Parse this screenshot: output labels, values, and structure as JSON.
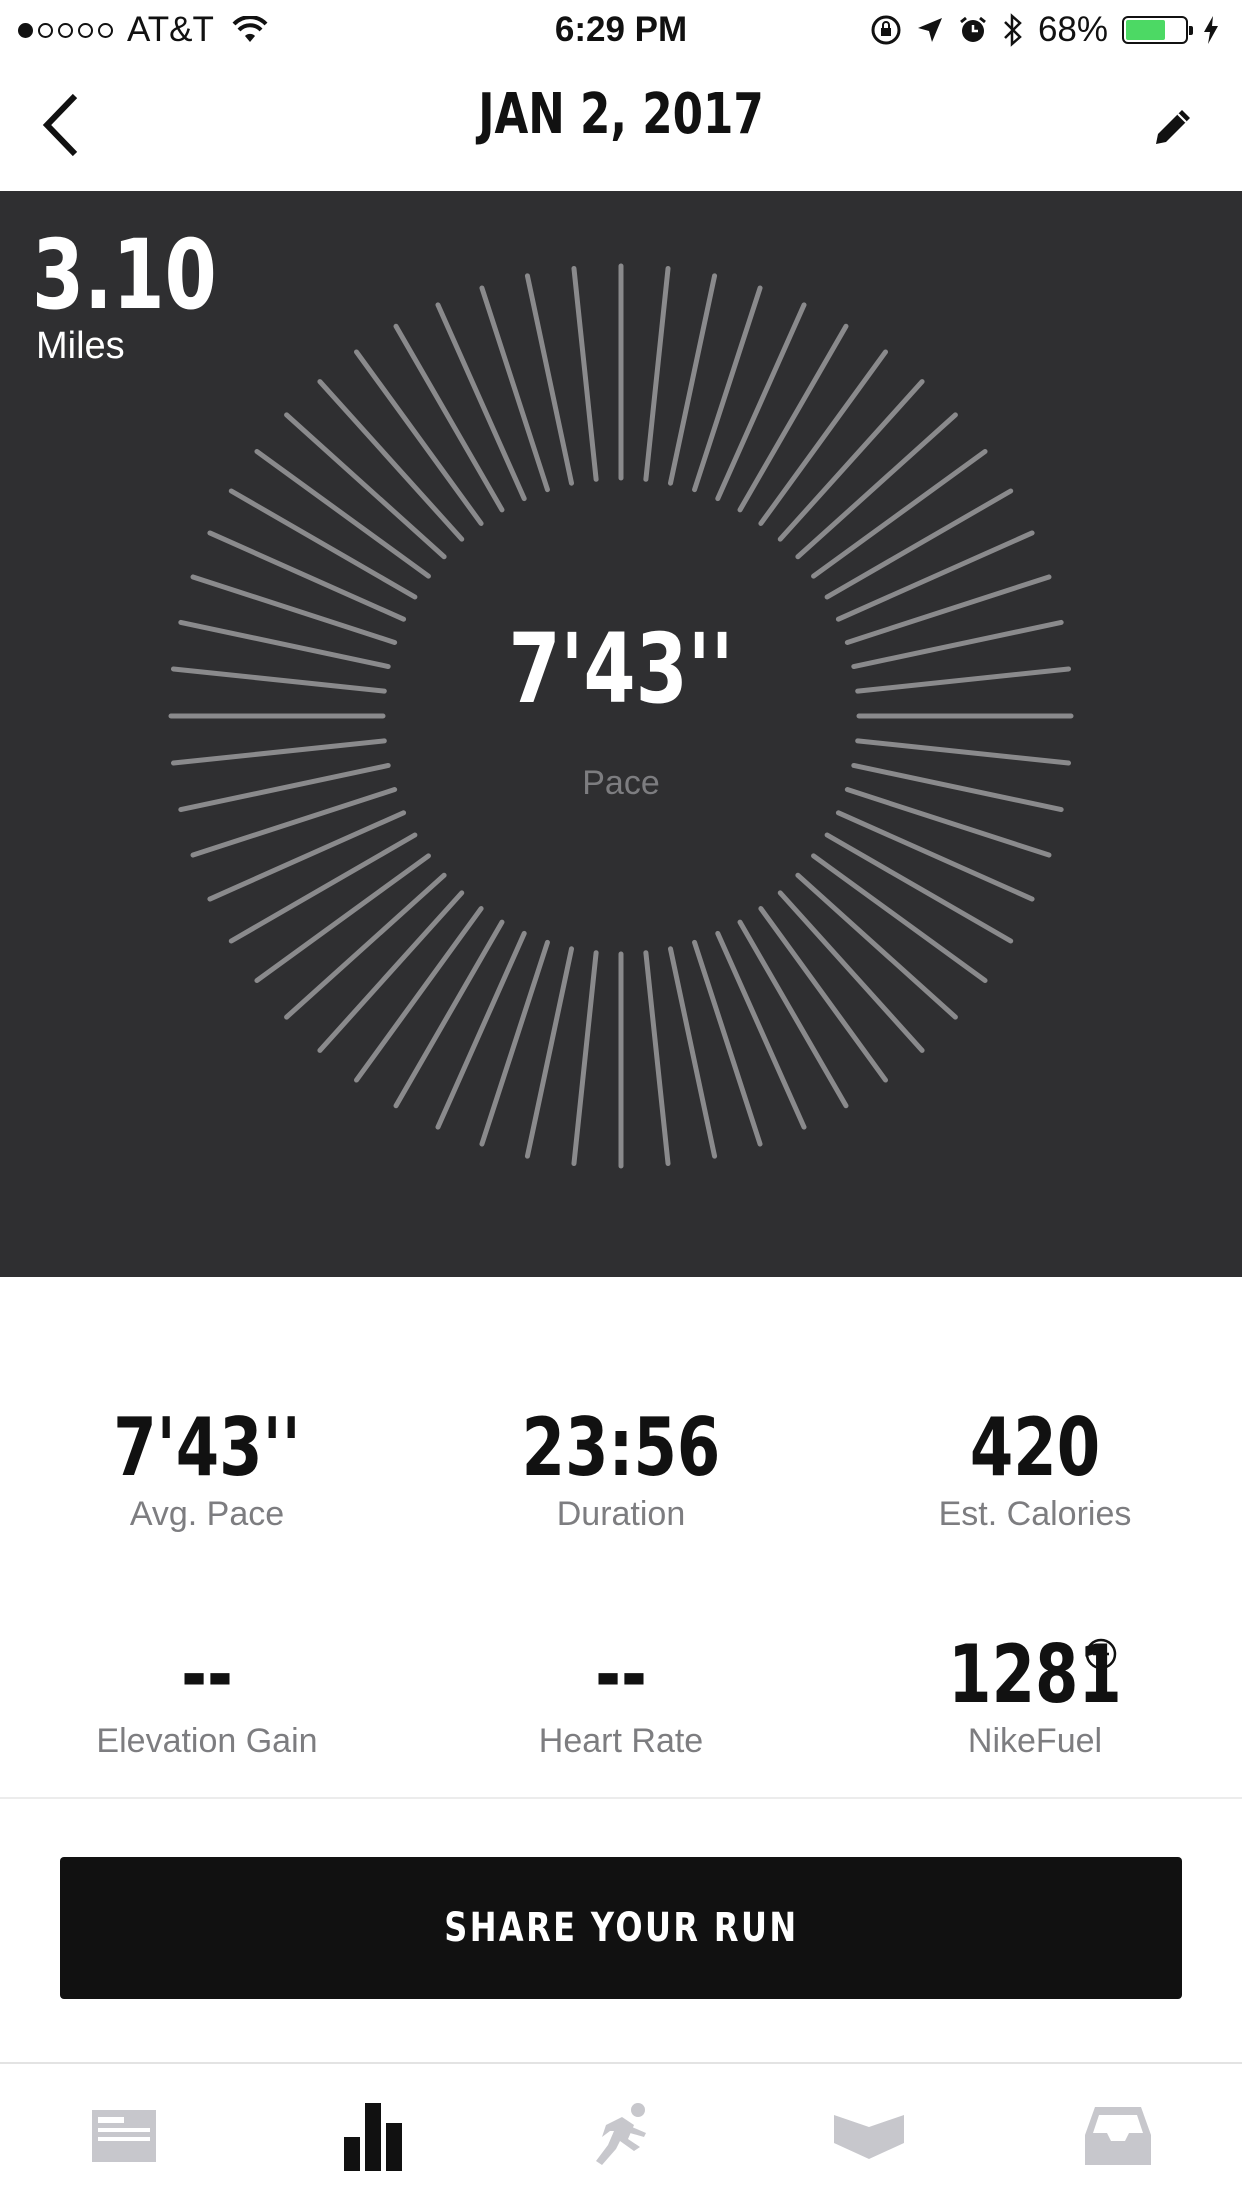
{
  "status_bar": {
    "carrier": "AT&T",
    "time": "6:29 PM",
    "battery_percent": "68%",
    "battery_level": 0.68,
    "signal_bars_filled": 1,
    "signal_bars_total": 5,
    "icons": [
      "wifi-icon",
      "orientation-lock-icon",
      "location-icon",
      "alarm-icon",
      "bluetooth-icon",
      "charging-icon"
    ]
  },
  "nav": {
    "title": "JAN 2, 2017",
    "back_icon": "chevron-left-icon",
    "edit_icon": "pencil-icon"
  },
  "hero": {
    "distance": "3.10",
    "distance_unit": "Miles",
    "pace": "7'43''",
    "pace_label": "Pace",
    "ring_color": "#8a8a8c",
    "background_color": "#2f2f31"
  },
  "stats": [
    {
      "value": "7'43''",
      "label": "Avg. Pace"
    },
    {
      "value": "23:56",
      "label": "Duration"
    },
    {
      "value": "420",
      "label": "Est. Calories"
    },
    {
      "value": "--",
      "label": "Elevation Gain"
    },
    {
      "value": "--",
      "label": "Heart Rate"
    },
    {
      "value": "1281",
      "label": "NikeFuel"
    }
  ],
  "share": {
    "label": "SHARE YOUR RUN"
  },
  "tabs": [
    {
      "name": "feed",
      "icon": "feed-icon",
      "active": false
    },
    {
      "name": "activity",
      "icon": "bar-chart-icon",
      "active": true
    },
    {
      "name": "run",
      "icon": "runner-icon",
      "active": false
    },
    {
      "name": "coach",
      "icon": "coach-icon",
      "active": false
    },
    {
      "name": "inbox",
      "icon": "inbox-icon",
      "active": false
    }
  ],
  "colors": {
    "accent_battery": "#4cd964",
    "button_bg": "#111111",
    "label_gray": "#7d7d80",
    "tab_active": "#111111",
    "tab_inactive": "#c7c7cc"
  }
}
